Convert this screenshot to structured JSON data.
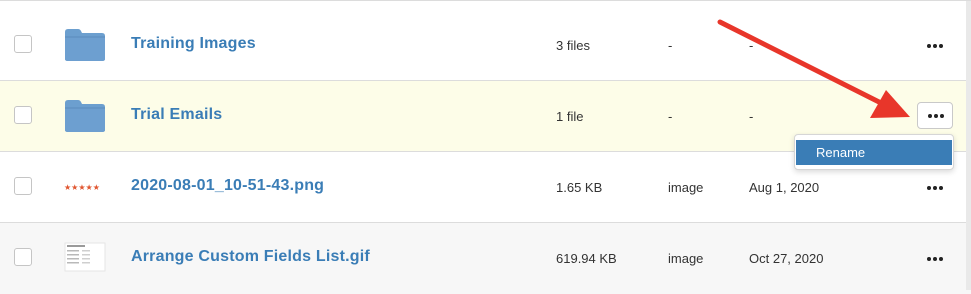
{
  "rows": [
    {
      "name": "Training Images",
      "size": "3 files",
      "type": "-",
      "date": "-",
      "icon": "folder-icon"
    },
    {
      "name": "Trial Emails",
      "size": "1 file",
      "type": "-",
      "date": "-",
      "icon": "folder-icon"
    },
    {
      "name": "2020-08-01_10-51-43.png",
      "size": "1.65 KB",
      "type": "image",
      "date": "Aug 1, 2020",
      "icon": "image-thumbnail-stars"
    },
    {
      "name": "Arrange Custom Fields List.gif",
      "size": "619.94 KB",
      "type": "image",
      "date": "Oct 27, 2020",
      "icon": "image-thumbnail-list"
    }
  ],
  "dropdown": {
    "items": [
      {
        "label": "Rename"
      }
    ]
  },
  "colors": {
    "link": "#3a7db6",
    "highlight_row": "#fdfde8",
    "annotation_arrow": "#e8362a",
    "menu_selected": "#3a7db6"
  }
}
